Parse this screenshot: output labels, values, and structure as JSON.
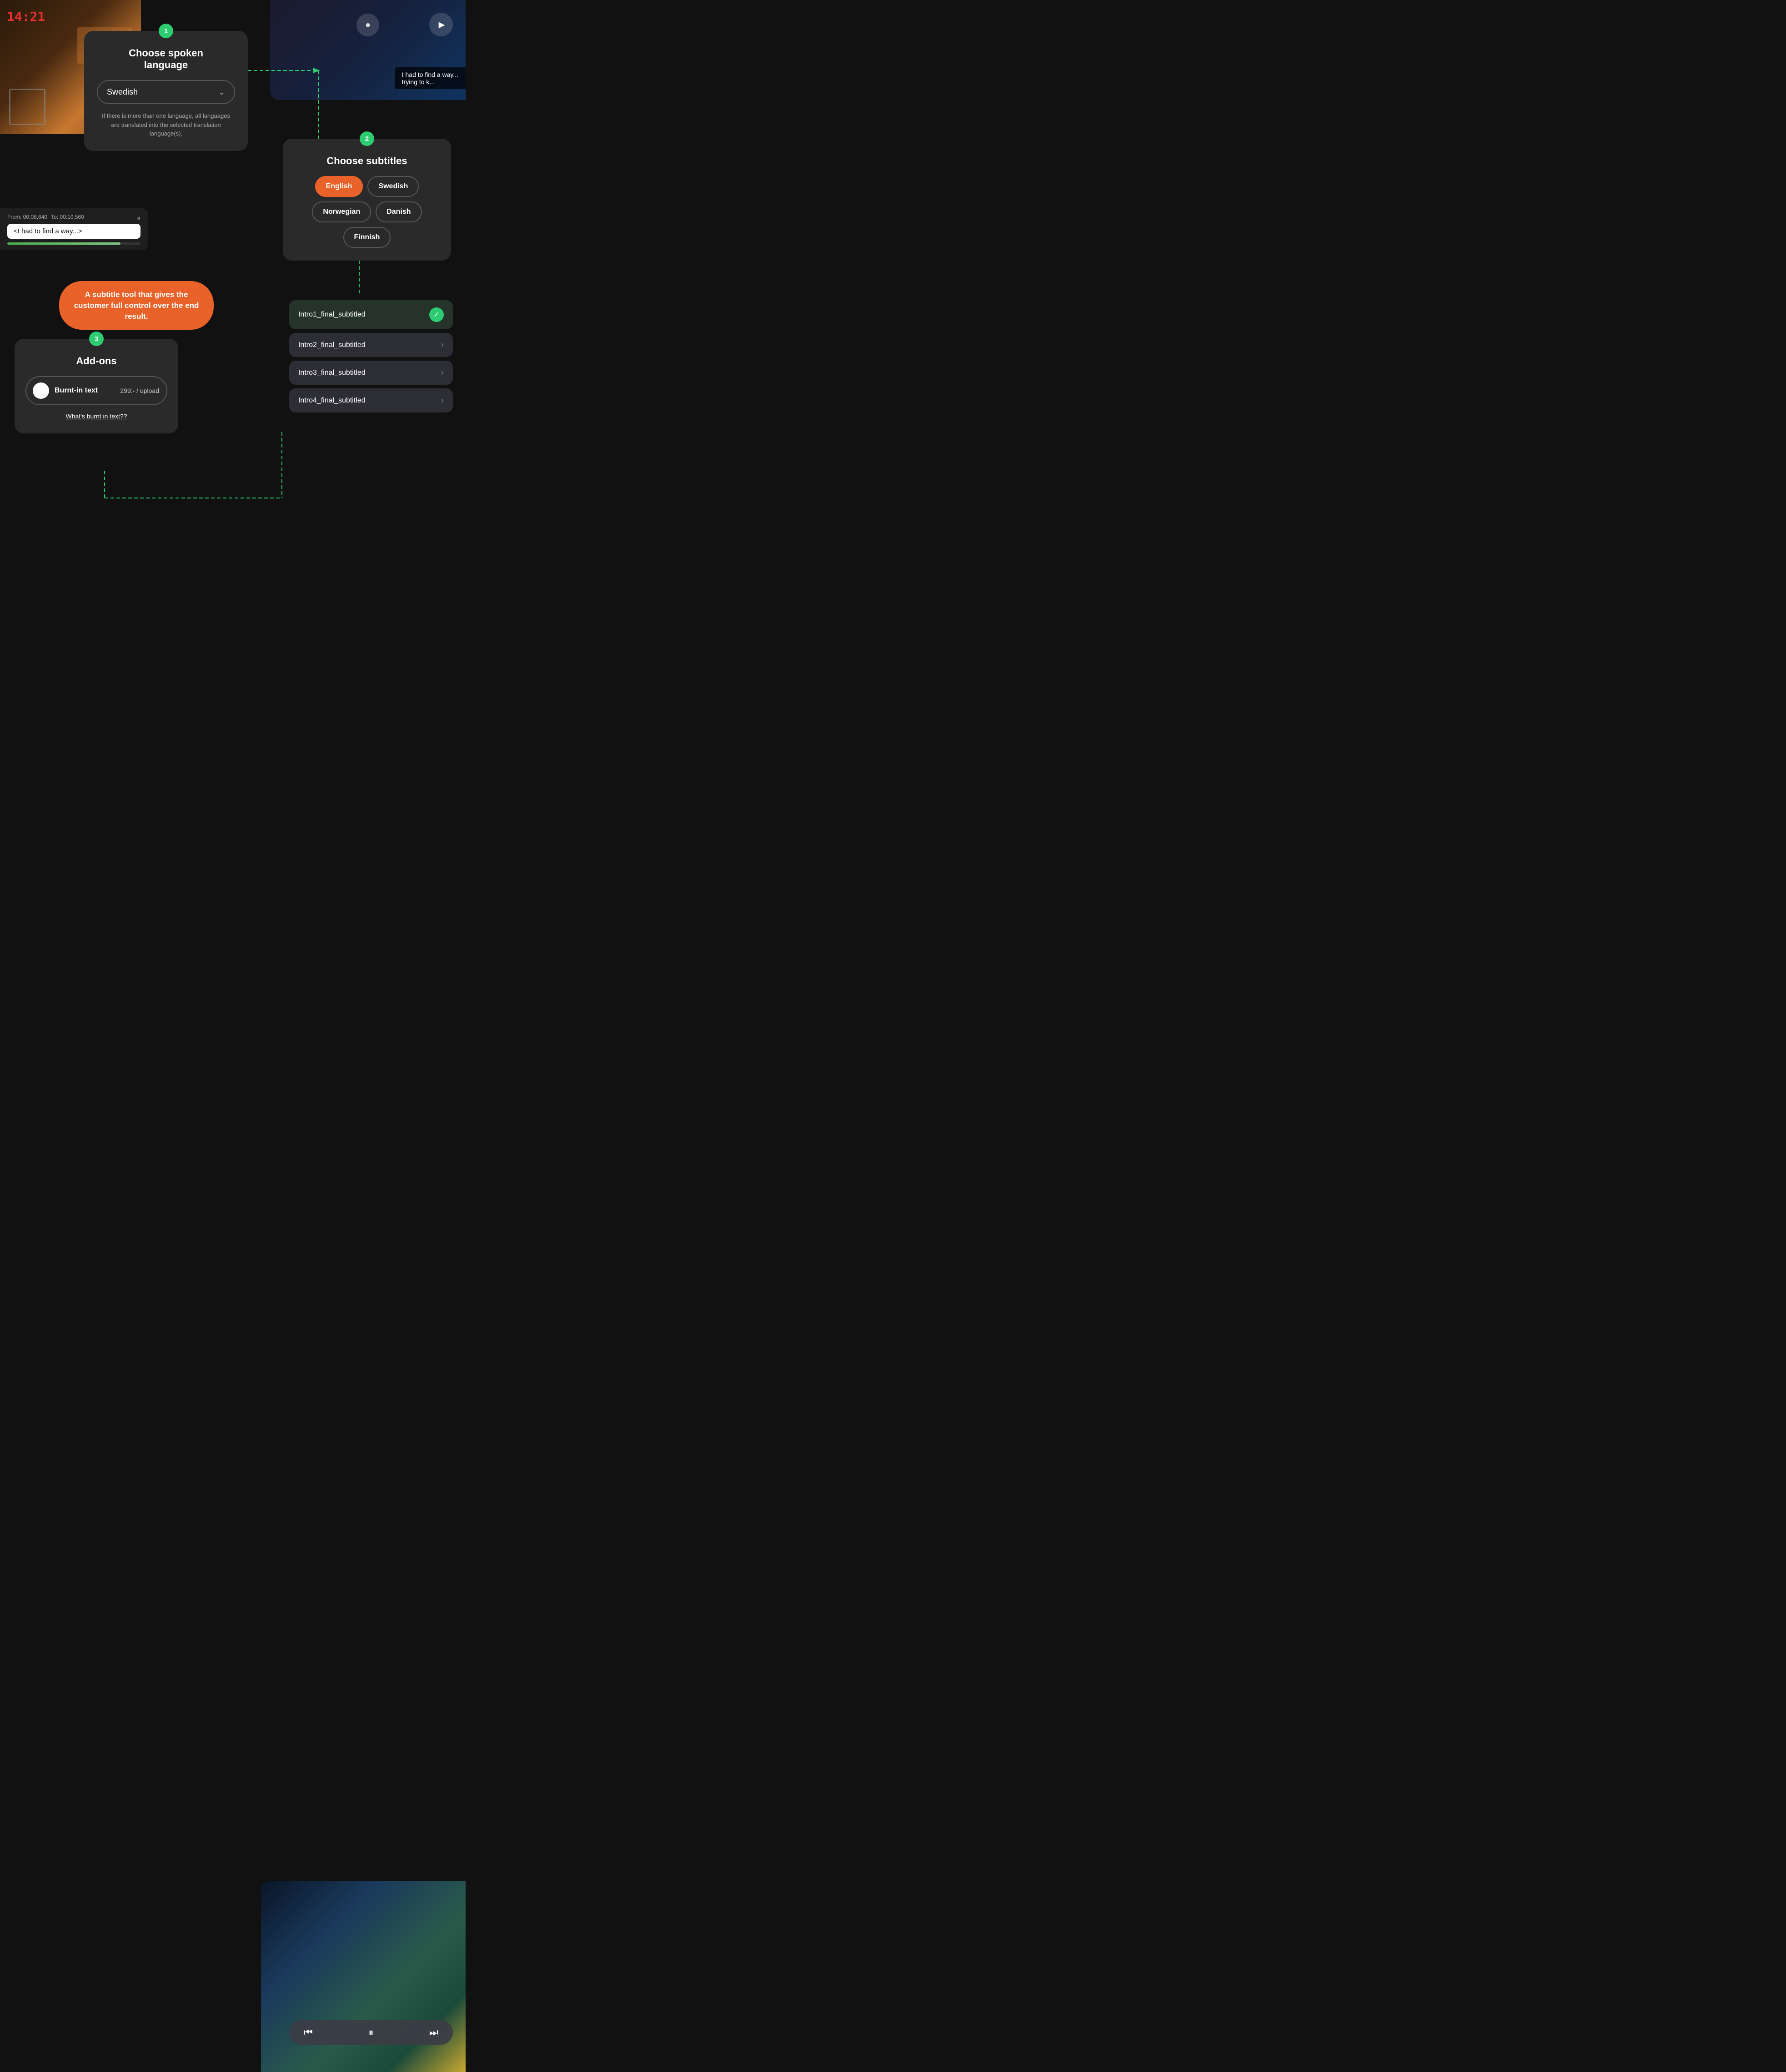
{
  "background": {
    "topLeft": "film-clapper-bg",
    "topRight": "dark-studio-bg",
    "bottomRight": "colorful-abstract-bg"
  },
  "videoSubtitle": {
    "line1": "I had to find a way...",
    "line2": "trying to k..."
  },
  "timelineBar": {
    "from": "From: 00:08,640",
    "to": "To: 00:10,560",
    "text": "<I had to find a way...>"
  },
  "card1": {
    "stepNumber": "1",
    "title": "Choose spoken\nlanguage",
    "selectedLanguage": "Swedish",
    "hint": "If there is more than one language, all languages are translated into the selected translation language(s)."
  },
  "card2": {
    "stepNumber": "2",
    "title": "Choose subtitles",
    "options": [
      {
        "label": "English",
        "active": true
      },
      {
        "label": "Swedish",
        "active": false
      },
      {
        "label": "Norwegian",
        "active": false
      },
      {
        "label": "Danish",
        "active": false
      },
      {
        "label": "Finnish",
        "active": false
      }
    ]
  },
  "promoBadge": {
    "text": "A subtitle tool that gives the customer full control over the end result."
  },
  "card3": {
    "stepNumber": "3",
    "title": "Add-ons",
    "addon": {
      "name": "Burnt-in text",
      "price": "299:- / upload"
    },
    "link": "What's burnt in text??"
  },
  "fileList": [
    {
      "name": "Intro1_final_subtitled",
      "status": "completed"
    },
    {
      "name": "Intro2_final_subtitled",
      "status": "pending"
    },
    {
      "name": "Intro3_final_subtitled",
      "status": "pending"
    },
    {
      "name": "Intro4_final_subtitled",
      "status": "pending"
    }
  ],
  "mediaControls": {
    "skipBack": "⏮",
    "pause": "⏸",
    "skipForward": "⏭"
  }
}
